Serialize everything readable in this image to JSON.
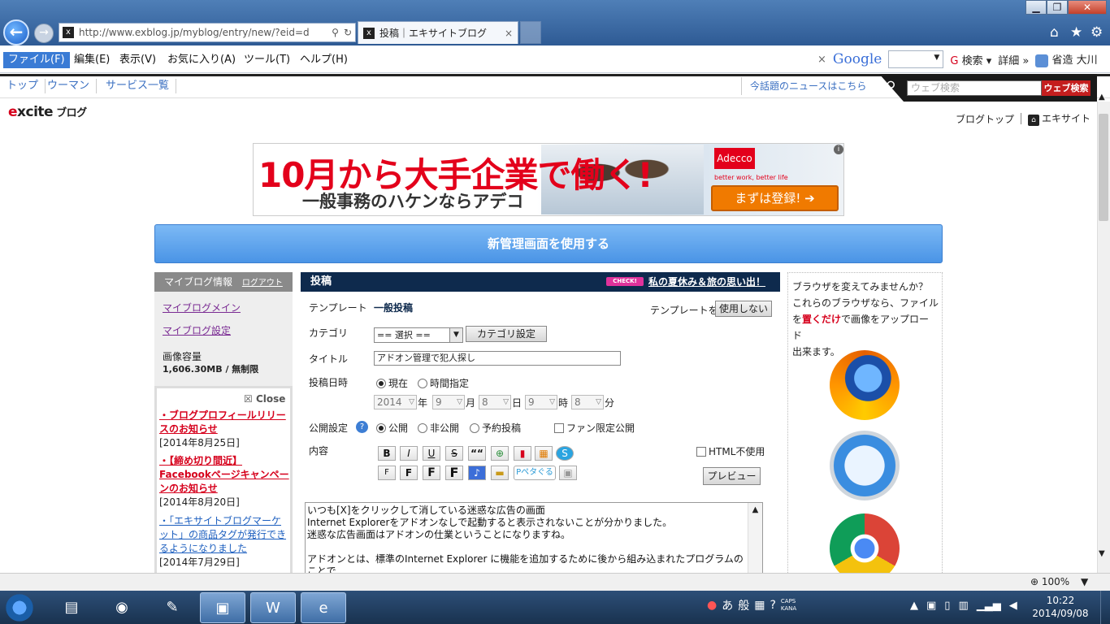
{
  "browser": {
    "url": "http://www.exblog.jp/myblog/entry/new/?eid=d",
    "tab_title": "投稿｜エキサイトブログ",
    "tab_close": "×",
    "menu": [
      "ファイル(F)",
      "編集(E)",
      "表示(V)",
      "お気に入り(A)",
      "ツール(T)",
      "ヘルプ(H)"
    ],
    "toolbar": {
      "close_x": "×",
      "google": "Google",
      "search_label": "検索",
      "details": "詳細 »",
      "user": "省造 大川"
    },
    "zoom": "100%"
  },
  "excite_nav": {
    "links": [
      "トップ",
      "ウーマン",
      "サービス一覧"
    ],
    "news": "今話題のニュースはこちら",
    "search_placeholder": "ウェブ検索",
    "search_button": "ウェブ検索"
  },
  "header": {
    "logo": "excite",
    "logo_sub": "ブログ",
    "blog_top": "ブログトップ",
    "excite_link": "エキサイト"
  },
  "ad": {
    "headline": "10月から大手企業で働く!",
    "sub": "一般事務のハケンならアデコ",
    "brand": "Adecco",
    "tagline": "better work, better life",
    "cta": "まずは登録! ➔",
    "info": "i"
  },
  "new_admin_button": "新管理画面を使用する",
  "left_panel": {
    "title": "マイブログ情報",
    "logout": "ログアウト",
    "links": [
      "マイブログメイン",
      "マイブログ設定"
    ],
    "capacity_label": "画像容量",
    "capacity_value": "1,606.30MB / 無制限",
    "close": "Close",
    "news": [
      {
        "title": "・ブログプロフィールリリースのお知らせ",
        "date": "[2014年8月25日]"
      },
      {
        "title": "・【締め切り間近】Facebookページキャンペーンのお知らせ",
        "date": "[2014年8月20日]"
      },
      {
        "title": "・「エキサイトブログマーケット」の商品タグが発行できるようになりました",
        "date": "[2014年7月29日]"
      }
    ]
  },
  "post_form": {
    "header": "投稿",
    "check_badge": "CHECK!",
    "promo": "私の夏休み＆旅の思い出！",
    "template_label": "テンプレート",
    "template_value": "一般投稿",
    "template_with": "テンプレートを",
    "template_button": "使用しない",
    "category_label": "カテゴリ",
    "category_value": "== 選択 ==",
    "category_button": "カテゴリ設定",
    "title_label": "タイトル",
    "title_value": "アドオン管理で犯人探し",
    "datetime_label": "投稿日時",
    "datetime_options": [
      "現在",
      "時間指定"
    ],
    "date": {
      "year": "2014",
      "month": "9",
      "day": "8",
      "hour": "9",
      "minute": "8"
    },
    "date_units": [
      "年",
      "月",
      "日",
      "時",
      "分"
    ],
    "publish_label": "公開設定",
    "publish_options": [
      "公開",
      "非公開",
      "予約投稿"
    ],
    "fan_only": "ファン限定公開",
    "content_label": "内容",
    "html_off": "HTML不使用",
    "preview_button": "プレビュー",
    "toolbar_buttons": [
      "B",
      "I",
      "U",
      "S",
      "““",
      "F",
      "F",
      "F",
      "F"
    ],
    "petit_label": "Pペタぐる",
    "body_text": "いつも[X]をクリックして消している迷惑な広告の画面\nInternet Explorerをアドオンなしで起動すると表示されないことが分かりました。\n迷惑な広告画面はアドオンの仕業ということになりますね。\n\nアドオンとは、標準のInternet Explorer に機能を追加するために後から組み込まれたプログラムのことで\nす。ダウンロードで組み込まれるケースがほとんどで、YahooのツールバーやGoogleのツールバーはその"
  },
  "right_panel": {
    "line1": "ブラウザを変えてみませんか？",
    "line2": "これらのブラウザなら、ファイル",
    "line3_pre": "を",
    "line3_em": "置くだけ",
    "line3_post": "で画像をアップロード",
    "line4": "出来ます。"
  },
  "taskbar": {
    "ime": [
      "あ",
      "般"
    ],
    "caps": "CAPS",
    "kana": "KANA",
    "time": "10:22",
    "date": "2014/09/08"
  }
}
